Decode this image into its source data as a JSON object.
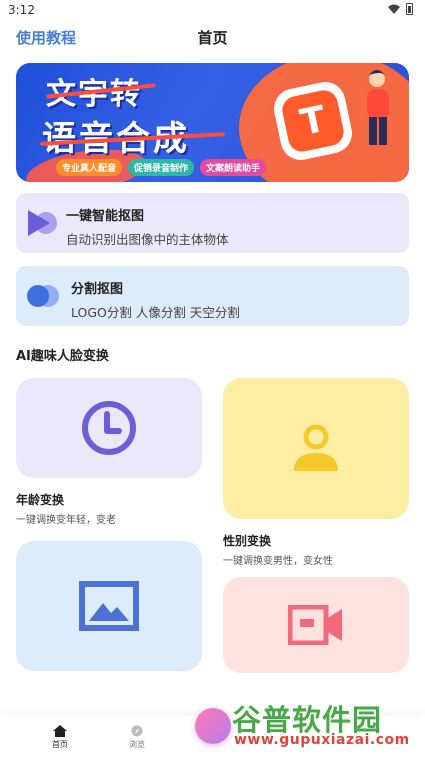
{
  "status_bar": {
    "time": "3:12"
  },
  "header": {
    "tutorial": "使用教程",
    "title": "首页"
  },
  "banner": {
    "line1": "文字转",
    "line2": "语音合成",
    "tags": [
      "专业真人配音",
      "促销录音制作",
      "文案朗读助手"
    ],
    "logo_letter": "T"
  },
  "features": [
    {
      "title": "一键智能抠图",
      "desc": "自动识别出图像中的主体物体",
      "icon": "play-triangle-icon",
      "color": "#7b6ee8"
    },
    {
      "title": "分割抠图",
      "desc": "LOGO分割 人像分割 天空分割",
      "icon": "overlap-circles-icon",
      "color": "#3f6ee0"
    }
  ],
  "section": {
    "title": "AI趣味人脸变换"
  },
  "tiles": [
    {
      "label": "年龄变换",
      "sub": "一键调换变年轻，变老",
      "icon": "clock-icon",
      "color": "#6b5fd8"
    },
    {
      "label": "性别变换",
      "sub": "一键调换变男性，变女性",
      "icon": "person-icon",
      "color": "#f5c92c"
    },
    {
      "label": "",
      "sub": "",
      "icon": "image-icon",
      "color": "#4d72d6"
    },
    {
      "label": "",
      "sub": "",
      "icon": "video-camera-icon",
      "color": "#f26b7a"
    }
  ],
  "bottom_nav": {
    "items": [
      {
        "label": "首页",
        "icon": "home-icon"
      },
      {
        "label": "浏览",
        "icon": "compass-icon"
      }
    ]
  },
  "watermark": {
    "main": "谷普软件园",
    "url": "www.gupuxiazai.com"
  }
}
